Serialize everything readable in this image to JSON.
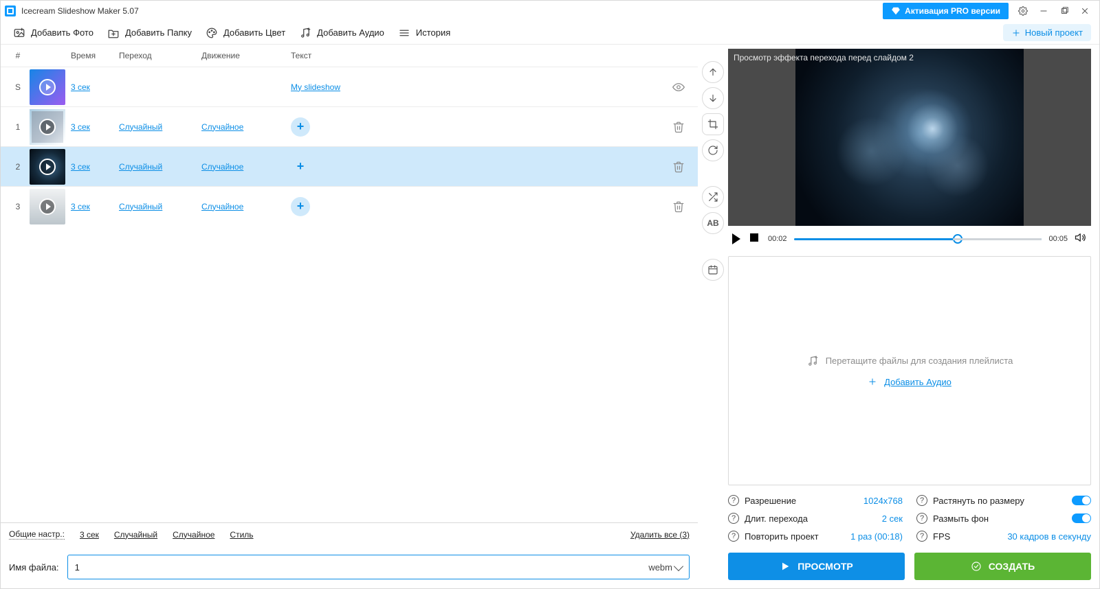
{
  "titlebar": {
    "app_title": "Icecream Slideshow Maker 5.07",
    "pro_label": "Активация PRO версии"
  },
  "toolbar": {
    "add_photo": "Добавить Фото",
    "add_folder": "Добавить Папку",
    "add_color": "Добавить Цвет",
    "add_audio": "Добавить Аудио",
    "history": "История",
    "new_project": "Новый проект"
  },
  "table": {
    "headers": {
      "idx": "#",
      "time": "Время",
      "trans": "Переход",
      "move": "Движение",
      "text": "Текст"
    },
    "rows": [
      {
        "idx": "S",
        "time": "3 сек",
        "trans": "",
        "move": "",
        "text": "My slideshow",
        "action": "eye"
      },
      {
        "idx": "1",
        "time": "3 сек",
        "trans": "Случайный",
        "move": "Случайное",
        "action": "trash"
      },
      {
        "idx": "2",
        "time": "3 сек",
        "trans": "Случайный",
        "move": "Случайное",
        "action": "trash",
        "selected": true
      },
      {
        "idx": "3",
        "time": "3 сек",
        "trans": "Случайный",
        "move": "Случайное",
        "action": "trash"
      }
    ],
    "general": {
      "label": "Общие настр.:",
      "time": "3 сек",
      "trans": "Случайный",
      "move": "Случайное",
      "style": "Стиль",
      "delete_all": "Удалить все (3)"
    }
  },
  "filename": {
    "label": "Имя файла:",
    "value": "1",
    "format": "webm"
  },
  "preview": {
    "overlay": "Просмотр эффекта перехода перед слайдом 2",
    "t_cur": "00:02",
    "t_end": "00:05"
  },
  "audio": {
    "drop_hint": "Перетащите файлы для создания плейлиста",
    "add_audio": "Добавить Аудио"
  },
  "settings": {
    "resolution": {
      "label": "Разрешение",
      "value": "1024x768"
    },
    "stretch": {
      "label": "Растянуть по размеру"
    },
    "transition": {
      "label": "Длит. перехода",
      "value": "2 сек"
    },
    "blur": {
      "label": "Размыть фон"
    },
    "repeat": {
      "label": "Повторить проект",
      "value": "1 раз (00:18)"
    },
    "fps": {
      "label": "FPS",
      "value": "30 кадров в секунду"
    }
  },
  "actions": {
    "preview": "ПРОСМОТР",
    "create": "СОЗДАТЬ"
  }
}
